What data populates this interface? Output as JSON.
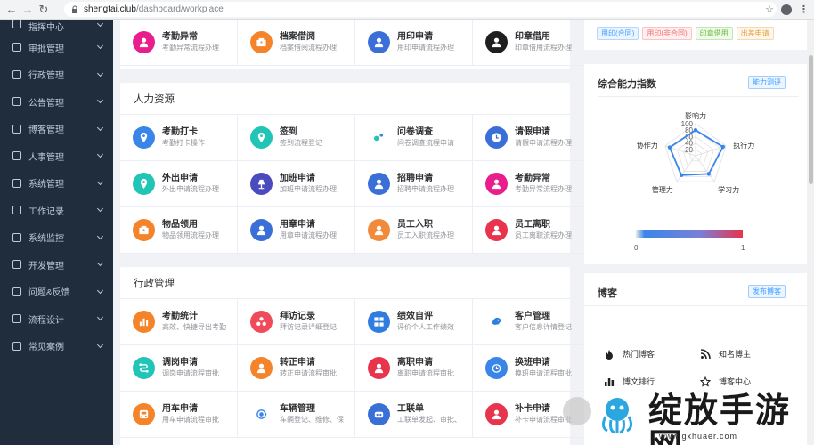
{
  "browser": {
    "url_host": "shengtai.club",
    "url_path": "/dashboard/workplace"
  },
  "sidebar": {
    "items": [
      {
        "label": "指挥中心",
        "icon": "chart-icon"
      },
      {
        "label": "审批管理",
        "icon": "lightning-icon"
      },
      {
        "label": "行政管理",
        "icon": "people-icon"
      },
      {
        "label": "公告管理",
        "icon": "video-icon"
      },
      {
        "label": "博客管理",
        "icon": "edit-icon"
      },
      {
        "label": "人事管理",
        "icon": "user-icon"
      },
      {
        "label": "系统管理",
        "icon": "gear-icon"
      },
      {
        "label": "工作记录",
        "icon": "monitor-icon"
      },
      {
        "label": "系统监控",
        "icon": "gauge-icon"
      },
      {
        "label": "开发管理",
        "icon": "cloud-icon"
      },
      {
        "label": "问题&反馈",
        "icon": "branch-icon"
      },
      {
        "label": "流程设计",
        "icon": "compass-icon"
      },
      {
        "label": "常见案例",
        "icon": "grid-icon"
      }
    ]
  },
  "top_panel": {
    "items": [
      {
        "title": "考勤异常",
        "sub": "考勤异常流程办理",
        "color": "#e91e8c",
        "icon": "user-icon"
      },
      {
        "title": "档案借阅",
        "sub": "档案借阅流程办理",
        "color": "#f5832a",
        "icon": "box-icon"
      },
      {
        "title": "用印申请",
        "sub": "用印申请流程办理",
        "color": "#3a6fd8",
        "icon": "user-icon"
      },
      {
        "title": "印章借用",
        "sub": "印章借用流程办理",
        "color": "#1f1f1f",
        "icon": "user-icon"
      }
    ]
  },
  "hr_panel": {
    "title": "人力资源",
    "items": [
      {
        "title": "考勤打卡",
        "sub": "考勤打卡操作",
        "color": "#3a86e8",
        "icon": "pin-icon"
      },
      {
        "title": "签到",
        "sub": "签到流程登记",
        "color": "#20c5b5",
        "icon": "pin-icon"
      },
      {
        "title": "问卷调查",
        "sub": "问卷调查流程申请",
        "color": "#ffffff",
        "icon": "dots-icon"
      },
      {
        "title": "请假申请",
        "sub": "请假申请流程办理",
        "color": "#3a6fd8",
        "icon": "clock-icon"
      },
      {
        "title": "外出申请",
        "sub": "外出申请流程办理",
        "color": "#20c5b5",
        "icon": "pin-icon"
      },
      {
        "title": "加班申请",
        "sub": "加班申请流程办理",
        "color": "#4a4bbd",
        "icon": "lamp-icon"
      },
      {
        "title": "招聘申请",
        "sub": "招聘申请流程办理",
        "color": "#3a6fd8",
        "icon": "user-icon"
      },
      {
        "title": "考勤异常",
        "sub": "考勤异常流程办理",
        "color": "#e91e8c",
        "icon": "user-icon"
      },
      {
        "title": "物品领用",
        "sub": "物品领用流程办理",
        "color": "#f5832a",
        "icon": "box-icon"
      },
      {
        "title": "用章申请",
        "sub": "用章申请流程办理",
        "color": "#3a6fd8",
        "icon": "user-icon"
      },
      {
        "title": "员工入职",
        "sub": "员工入职流程办理",
        "color": "#f28a3c",
        "icon": "user-icon"
      },
      {
        "title": "员工离职",
        "sub": "员工离职流程办理",
        "color": "#e8344c",
        "icon": "user-icon"
      }
    ]
  },
  "admin_panel": {
    "title": "行政管理",
    "items": [
      {
        "title": "考勤统计",
        "sub": "高效、快捷导出考勤",
        "color": "#f5832a",
        "icon": "bars-icon"
      },
      {
        "title": "拜访记录",
        "sub": "拜访记录详细登记",
        "color": "#ef4b5a",
        "icon": "people-icon"
      },
      {
        "title": "绩效自评",
        "sub": "评价个人工作绩效",
        "color": "#2f7de1",
        "icon": "grid-icon"
      },
      {
        "title": "客户管理",
        "sub": "客户信息详情登记",
        "color": "#ffffff",
        "icon": "mascot-icon"
      },
      {
        "title": "调岗申请",
        "sub": "调岗申请流程审批",
        "color": "#20c5b5",
        "icon": "route-icon"
      },
      {
        "title": "转正申请",
        "sub": "转正申请流程审批",
        "color": "#f5832a",
        "icon": "user-icon"
      },
      {
        "title": "离职申请",
        "sub": "离职申请流程审批",
        "color": "#e8344c",
        "icon": "user-icon"
      },
      {
        "title": "换班申请",
        "sub": "换班申请流程审批",
        "color": "#3a86e8",
        "icon": "alarm-icon"
      },
      {
        "title": "用车申请",
        "sub": "用车申请流程审批",
        "color": "#f5832a",
        "icon": "car-icon"
      },
      {
        "title": "车辆管理",
        "sub": "车辆登记、维修、保",
        "color": "#ffffff",
        "icon": "orbit-icon"
      },
      {
        "title": "工联单",
        "sub": "工联单发起、审批、",
        "color": "#3a6fd8",
        "icon": "robot-icon"
      },
      {
        "title": "补卡申请",
        "sub": "补卡申请流程审批",
        "color": "#e8344c",
        "icon": "user-icon"
      }
    ]
  },
  "tags_panel": {
    "tags": [
      {
        "label": "用印(合同)",
        "color": "#409eff",
        "bg": "#ecf5ff",
        "border": "#b3d8ff"
      },
      {
        "label": "用印(非合同)",
        "color": "#f56c6c",
        "bg": "#fef0f0",
        "border": "#fbc4c4"
      },
      {
        "label": "印章借用",
        "color": "#67c23a",
        "bg": "#f0f9eb",
        "border": "#c2e7b0"
      },
      {
        "label": "出差申请",
        "color": "#e6a23c",
        "bg": "#fdf6ec",
        "border": "#f5dab1"
      }
    ]
  },
  "ability_panel": {
    "title": "综合能力指数",
    "button": "能力测评",
    "radar_labels": [
      "影响力",
      "执行力",
      "学习力",
      "管理力",
      "协作力"
    ],
    "radar_ticks": [
      "100",
      "80",
      "60",
      "40",
      "20"
    ],
    "radar_values": [
      80,
      90,
      70,
      75,
      85
    ],
    "legend_min": "0",
    "legend_max": "1"
  },
  "blog_panel": {
    "title": "博客",
    "button": "发布博客",
    "items": [
      {
        "label": "热门博客",
        "icon": "fire-icon"
      },
      {
        "label": "知名博主",
        "icon": "rss-icon"
      },
      {
        "label": "博文排行",
        "icon": "bars-icon"
      },
      {
        "label": "博客中心",
        "icon": "star-icon"
      }
    ]
  },
  "watermark": {
    "text": "绽放手游网",
    "url": "www.gxhuaer.com"
  }
}
